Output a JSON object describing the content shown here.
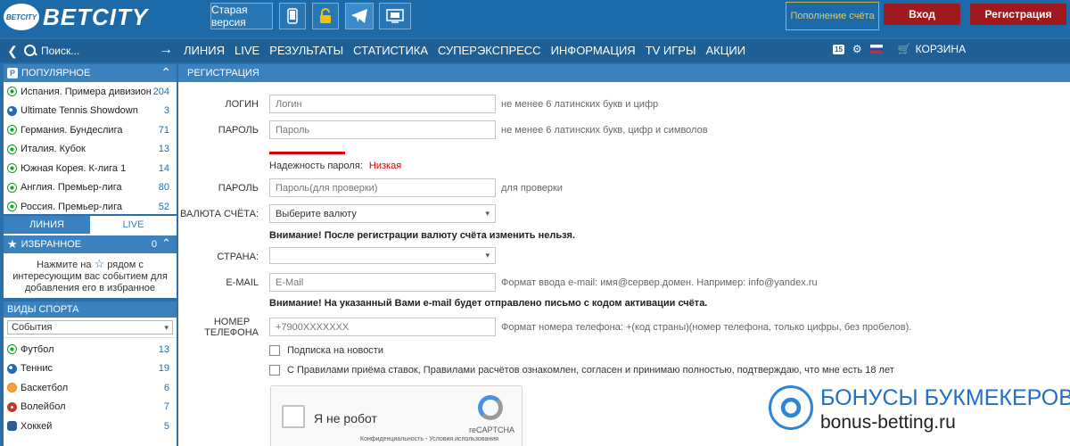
{
  "header": {
    "logo_ball_text": "BETCITY",
    "logo_text": "BETCITY",
    "old_version": "Старая версия",
    "icons": [
      "mobile-icon",
      "lock-icon",
      "telegram-icon",
      "tv-icon"
    ],
    "topup": "Пополнение счёта",
    "login": "Вход",
    "register": "Регистрация"
  },
  "nav": {
    "search_placeholder": "Поиск...",
    "items": [
      "ЛИНИЯ",
      "LIVE",
      "РЕЗУЛЬТАТЫ",
      "СТАТИСТИКА",
      "СУПЕРЭКСПРЕСС",
      "ИНФОРМАЦИЯ",
      "TV ИГРЫ",
      "АКЦИИ"
    ],
    "badge": "15",
    "cart": "КОРЗИНА"
  },
  "sidebar": {
    "popular_title": "ПОПУЛЯРНОЕ",
    "popular": [
      {
        "name": "Испания. Примера дивизион",
        "count": "204"
      },
      {
        "name": "Ultimate Tennis Showdown",
        "count": "3"
      },
      {
        "name": "Германия. Бундеслига",
        "count": "71"
      },
      {
        "name": "Италия. Кубок",
        "count": "13"
      },
      {
        "name": "Южная Корея. К-лига 1",
        "count": "14"
      },
      {
        "name": "Англия. Премьер-лига",
        "count": "80"
      },
      {
        "name": "Россия. Премьер-лига",
        "count": "52"
      }
    ],
    "tab_line": "ЛИНИЯ",
    "tab_live": "LIVE",
    "fav_title": "ИЗБРАННОЕ",
    "fav_count": "0",
    "fav_text_1": "Нажмите на",
    "fav_text_2": "рядом с интересующим вас событием для добавления его в избранное",
    "sports_title": "ВИДЫ СПОРТА",
    "events_select": "События",
    "sports": [
      {
        "name": "Футбол",
        "count": "13"
      },
      {
        "name": "Теннис",
        "count": "19"
      },
      {
        "name": "Баскетбол",
        "count": "6"
      },
      {
        "name": "Волейбол",
        "count": "7"
      },
      {
        "name": "Хоккей",
        "count": "5"
      }
    ]
  },
  "form": {
    "title": "РЕГИСТРАЦИЯ",
    "login_label": "ЛОГИН",
    "login_placeholder": "Логин",
    "login_hint": "не менее 6 латинских букв и цифр",
    "password_label": "ПАРОЛЬ",
    "password_placeholder": "Пароль",
    "password_hint": "не менее 6 латинских букв, цифр и символов",
    "strength_label": "Надежность пароля:",
    "strength_value": "Низкая",
    "password2_label": "ПАРОЛЬ",
    "password2_placeholder": "Пароль(для проверки)",
    "password2_hint": "для проверки",
    "currency_label": "ВАЛЮТА СЧЁТА:",
    "currency_value": "Выберите валюту",
    "currency_notice": "Внимание! После регистрации валюту счёта изменить нельзя.",
    "country_label": "СТРАНА:",
    "country_value": "",
    "email_label": "E-MAIL",
    "email_placeholder": "E-Mail",
    "email_hint": "Формат ввода e-mail: имя@сервер.домен. Например: info@yandex.ru",
    "email_notice": "Внимание! На указанный Вами e-mail будет отправлено письмо с кодом активации счёта.",
    "phone_label_1": "НОМЕР",
    "phone_label_2": "ТЕЛЕФОНА",
    "phone_placeholder": "+7900XXXXXXX",
    "phone_hint": "Формат номера телефона: +(код страны)(номер телефона, только цифры, без пробелов).",
    "newsletter": "Подписка на новости",
    "rules": "С Правилами приёма ставок, Правилами расчётов ознакомлен, согласен и принимаю полностью, подтверждаю, что мне есть 18 лет",
    "captcha_label": "Я не робот",
    "captcha_brand": "reCAPTCHA",
    "captcha_small": "Конфиденциальность - Условия использования"
  },
  "watermark": {
    "line1": "БОНУСЫ БУКМЕКЕРОВ",
    "line2": "bonus-betting.ru"
  },
  "colors": {
    "header_bg": "#1d6aa8",
    "accent_red": "#a0191e",
    "strength_low": "#e00000"
  }
}
